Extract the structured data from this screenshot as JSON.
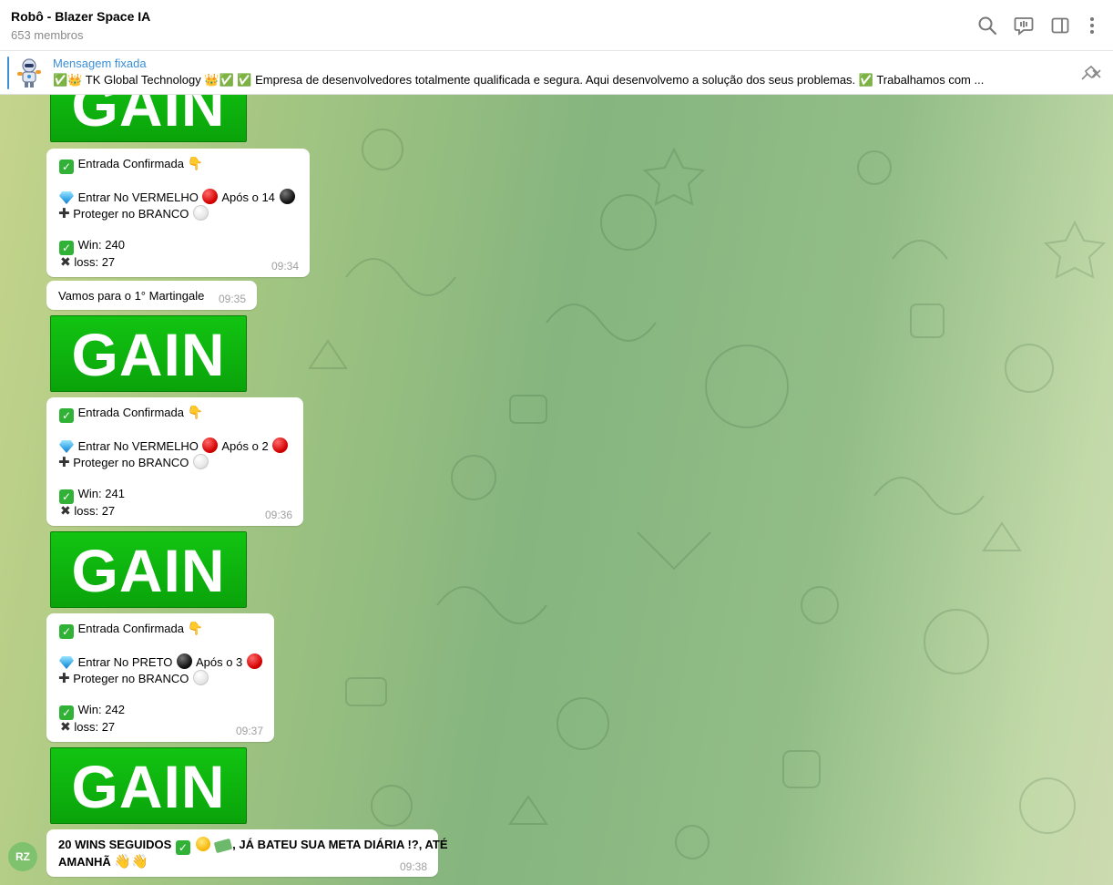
{
  "header": {
    "title": "Robô - Blazer Space IA",
    "subtitle": "653 membros",
    "icons": [
      "search-icon",
      "voice-chat-icon",
      "sidebar-toggle-icon",
      "more-options-icon"
    ]
  },
  "pinned": {
    "label": "Mensagem fixada",
    "text": "✅👑 TK Global Technology 👑✅     ✅ Empresa de desenvolvedores totalmente qualificada e segura.    Aqui desenvolvemo a solução dos seus problemas.    ✅ Trabalhamos com ..."
  },
  "gain_label": "GAIN",
  "messages": [
    {
      "confirm": "Entrada Confirmada",
      "enter_prefix": "Entrar No VERMELHO",
      "enter_after": "Após o 14",
      "protect": "Proteger no BRANCO",
      "win": "Win: 240",
      "loss": "loss: 27",
      "time": "09:34"
    },
    {
      "text": "Vamos para o 1° Martingale",
      "time": "09:35"
    },
    {
      "confirm": "Entrada Confirmada",
      "enter_prefix": "Entrar No VERMELHO",
      "enter_after": "Após o 2",
      "protect": "Proteger no BRANCO",
      "win": "Win: 241",
      "loss": "loss: 27",
      "time": "09:36"
    },
    {
      "confirm": "Entrada Confirmada",
      "enter_prefix": "Entrar No PRETO",
      "enter_after": "Após o 3",
      "protect": "Proteger no BRANCO",
      "win": "Win: 242",
      "loss": "loss: 27",
      "time": "09:37"
    },
    {
      "line1_a": "20 WINS SEGUIDOS",
      "line1_b": ", JÁ BATEU SUA META DIÁRIA !?, ATÉ",
      "line2": "AMANHÃ",
      "time": "09:38"
    }
  ],
  "avatar": {
    "initials": "RZ",
    "color": "#7ec26e"
  },
  "colors": {
    "accent": "#3a8fd6",
    "gain_green": "#0fb80f",
    "check_green": "#31b237"
  }
}
